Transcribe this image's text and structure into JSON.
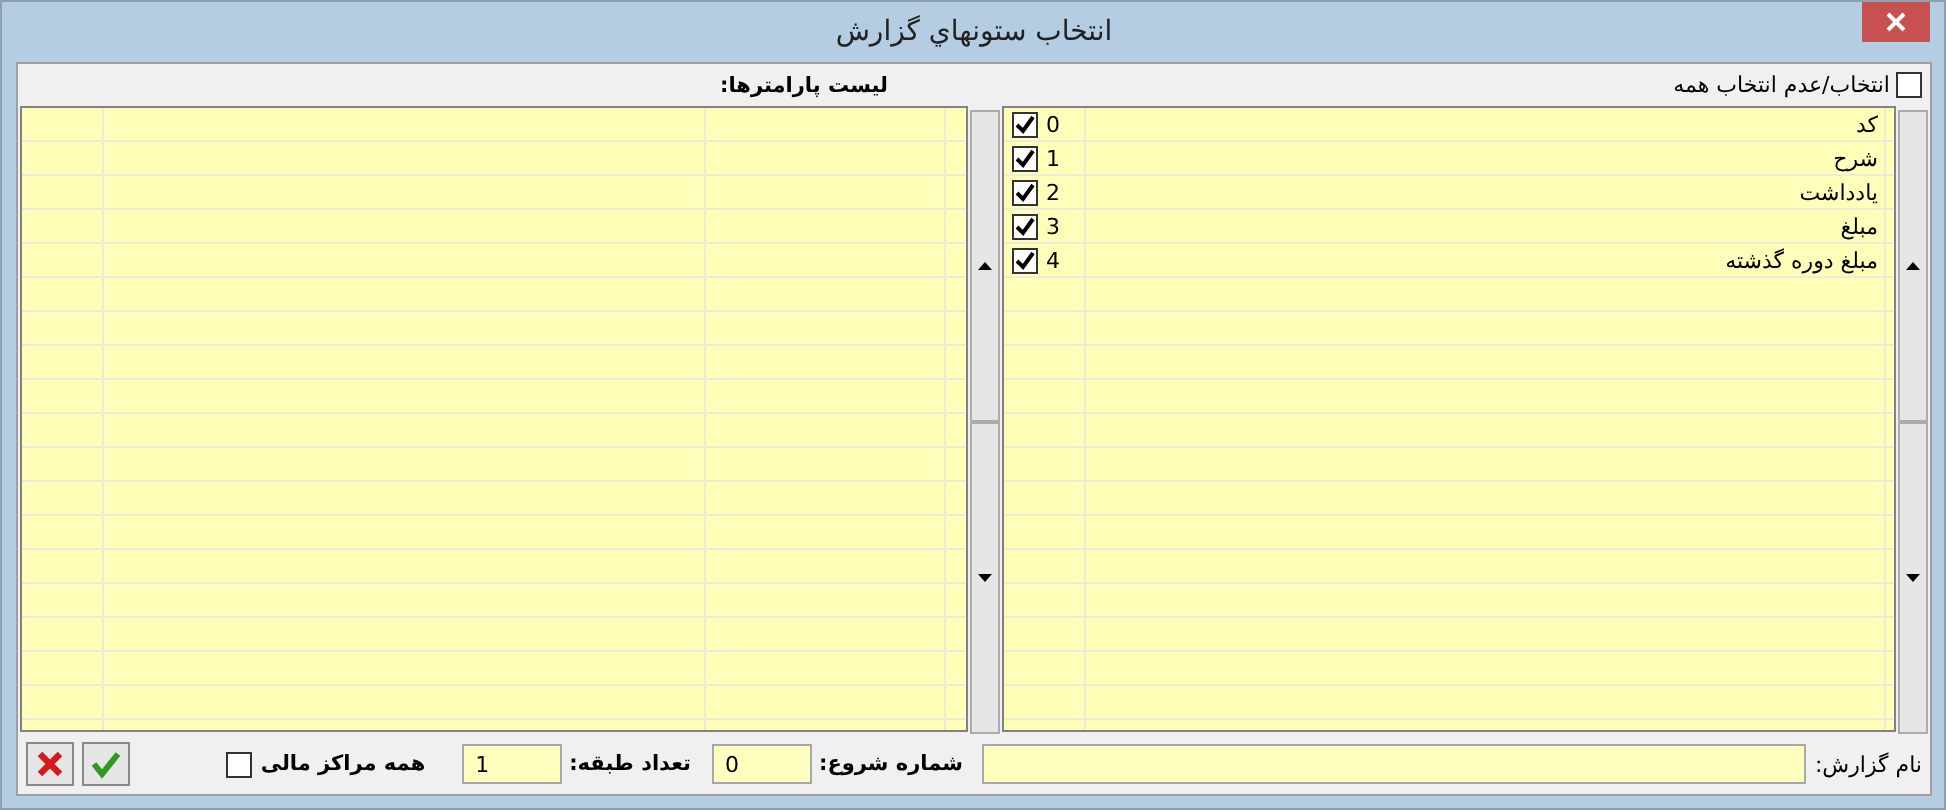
{
  "window": {
    "title": "انتخاب ستونهاي گزارش"
  },
  "select_all": {
    "label": "انتخاب/عدم انتخاب همه",
    "checked": false
  },
  "columns_list": [
    {
      "index": "0",
      "name": "کد",
      "checked": true
    },
    {
      "index": "1",
      "name": "شرح",
      "checked": true
    },
    {
      "index": "2",
      "name": "يادداشت",
      "checked": true
    },
    {
      "index": "3",
      "name": "مبلغ",
      "checked": true
    },
    {
      "index": "4",
      "name": "مبلغ دوره گذشته",
      "checked": true
    }
  ],
  "parameters": {
    "label": "ليست پارامترها:"
  },
  "footer": {
    "report_name": {
      "label": "نام گزارش:"
    },
    "start_number": {
      "label": "شماره شروع:",
      "value": "0"
    },
    "levels": {
      "label": "تعداد طبقه:",
      "value": "1"
    },
    "all_centers": {
      "label": "همه مراكز مالی",
      "checked": false
    }
  }
}
